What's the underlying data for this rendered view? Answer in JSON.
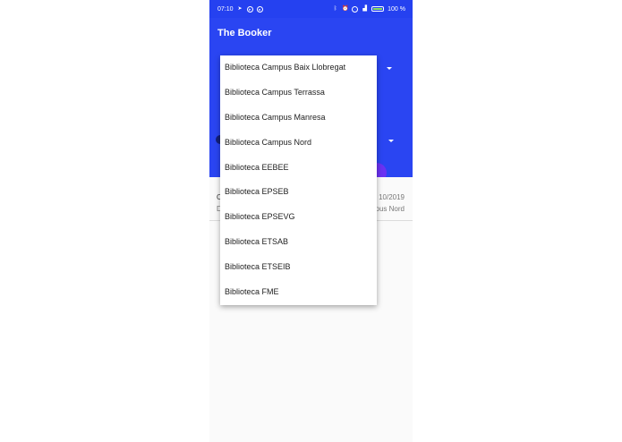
{
  "status_bar": {
    "time": "07:10",
    "battery_percent": "100 %",
    "icons_left": [
      "navigation-icon",
      "telegram-icon",
      "chrome-icon"
    ],
    "icons_right": [
      "bluetooth-icon",
      "alarm-icon",
      "clock-icon",
      "signal-icon",
      "battery-icon"
    ]
  },
  "app_bar": {
    "title": "The Booker"
  },
  "list_row": {
    "left_line_1": "C",
    "left_line_2": "D",
    "right_line_1": "10/2019",
    "right_line_2": "pus Nord"
  },
  "dropdown_menu": {
    "items": [
      "Biblioteca Campus Baix Llobregat",
      "Biblioteca Campus Terrassa",
      "Biblioteca Campus Manresa",
      "Biblioteca Campus Nord",
      "Biblioteca EEBEE",
      "Biblioteca EPSEB",
      "Biblioteca EPSEVG",
      "Biblioteca ETSAB",
      "Biblioteca ETSEIB",
      "Biblioteca FME"
    ]
  },
  "colors": {
    "primary": "#2a45f2",
    "accent": "#6a32f2",
    "background": "#fafafa"
  }
}
